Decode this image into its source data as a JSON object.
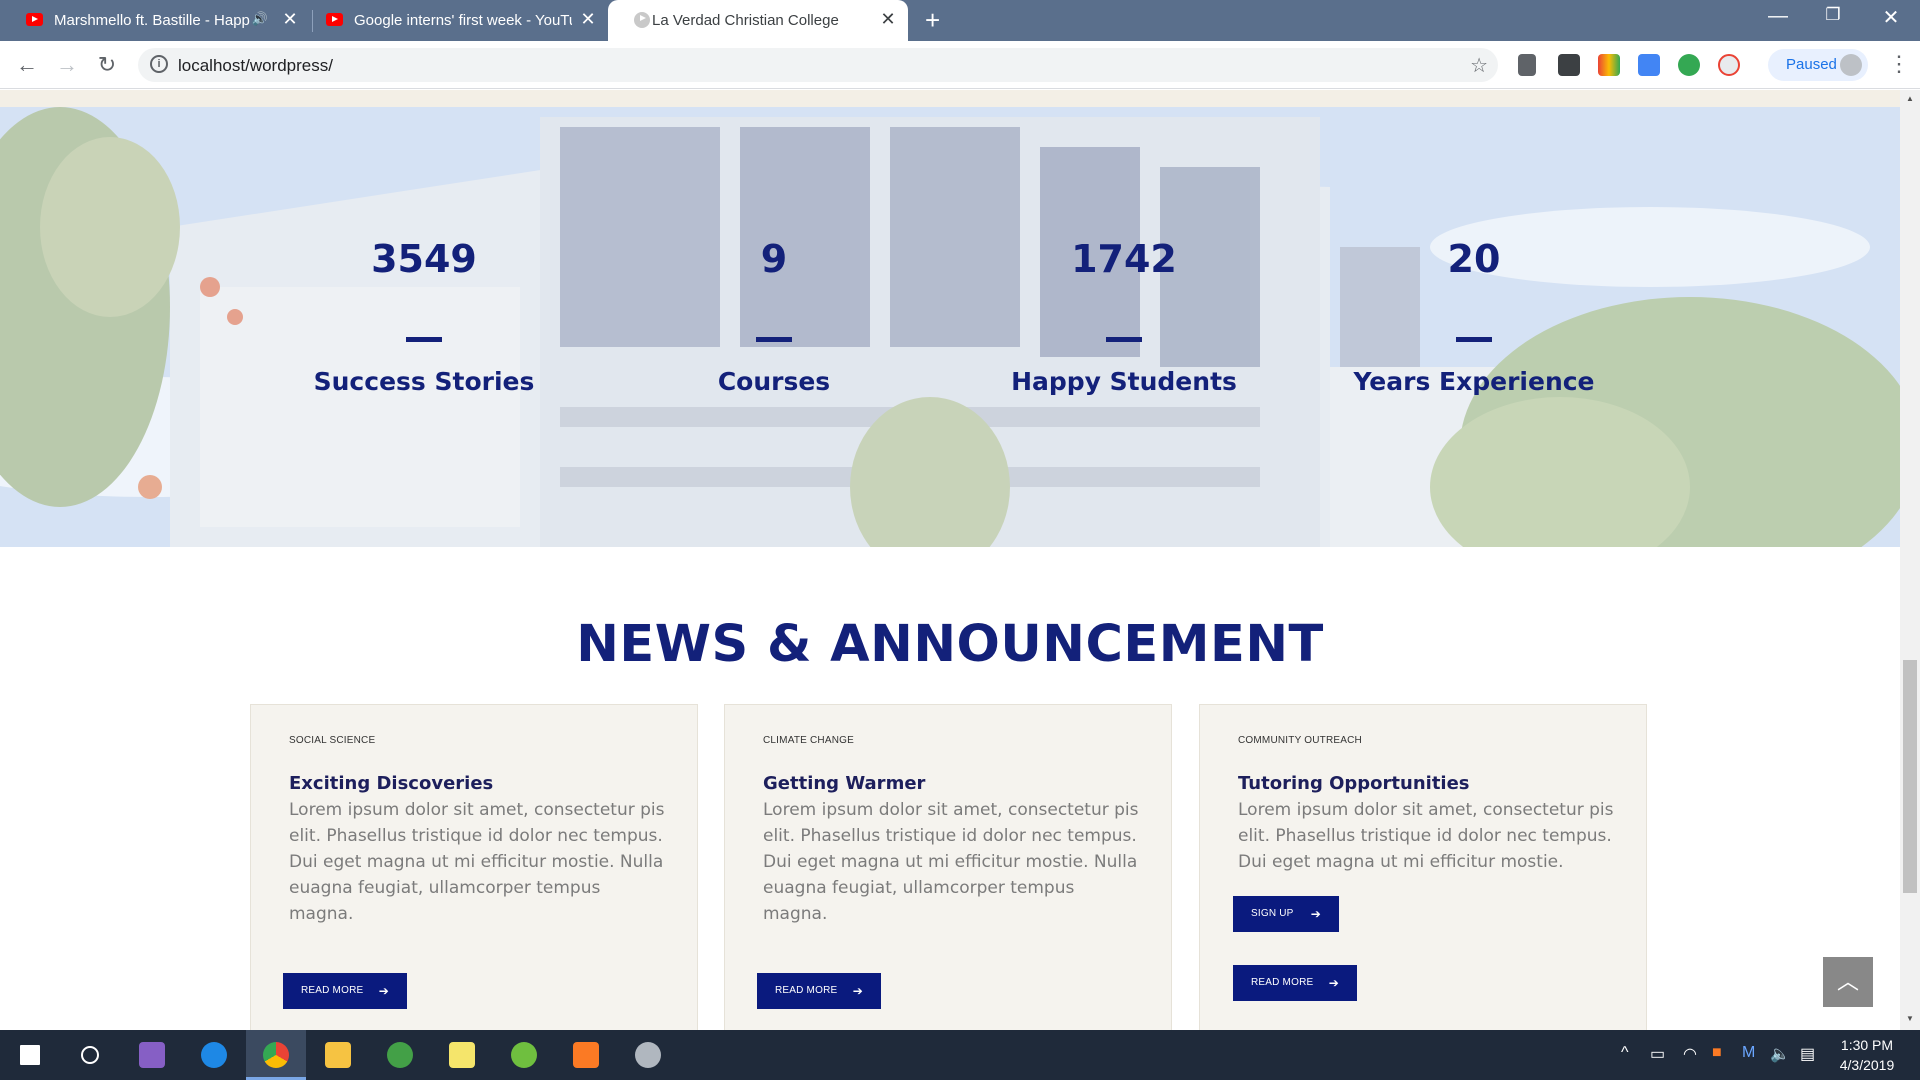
{
  "browser": {
    "tabs": [
      {
        "title": "Marshmello ft. Bastille - Happ",
        "audio_icon": "speaker-icon"
      },
      {
        "title": "Google interns' first week - YouTu"
      },
      {
        "title": "La Verdad Christian College"
      }
    ],
    "url": "localhost/wordpress/",
    "profile_label": "Paused"
  },
  "stats": [
    {
      "number": "3549",
      "label": "Success Stories"
    },
    {
      "number": "9",
      "label": "Courses"
    },
    {
      "number": "1742",
      "label": "Happy Students"
    },
    {
      "number": "20",
      "label": "Years Experience"
    }
  ],
  "news": {
    "title": "NEWS & ANNOUNCEMENT",
    "cards": [
      {
        "category": "SOCIAL SCIENCE",
        "title": "Exciting Discoveries",
        "body_lines": [
          "Lorem ipsum dolor sit amet, consectetur pis",
          "elit. Phasellus tristique id dolor nec tempus.",
          "Dui eget magna ut mi efficitur mostie. Nulla",
          "euagna feugiat, ullamcorper tempus magna."
        ],
        "buttons": [
          "READ MORE"
        ]
      },
      {
        "category": "CLIMATE CHANGE",
        "title": "Getting Warmer",
        "body_lines": [
          "Lorem ipsum dolor sit amet, consectetur pis",
          "elit. Phasellus tristique id dolor nec tempus.",
          "Dui eget magna ut mi efficitur mostie. Nulla",
          "euagna feugiat, ullamcorper tempus magna."
        ],
        "buttons": [
          "READ MORE"
        ]
      },
      {
        "category": "COMMUNITY OUTREACH",
        "title": "Tutoring Opportunities",
        "body_lines": [
          "Lorem ipsum dolor sit amet, consectetur pis",
          "elit. Phasellus tristique id dolor nec tempus.",
          "Dui eget magna ut mi efficitur mostie."
        ],
        "buttons": [
          "SIGN UP",
          "READ MORE"
        ]
      }
    ]
  },
  "taskbar": {
    "time": "1:30 PM",
    "date": "4/3/2019"
  },
  "colors": {
    "brand_navy": "#13217a",
    "button_navy": "#0a1a7e",
    "card_bg": "#f5f3ee",
    "chrome_tabbar": "#5a6f8c"
  }
}
